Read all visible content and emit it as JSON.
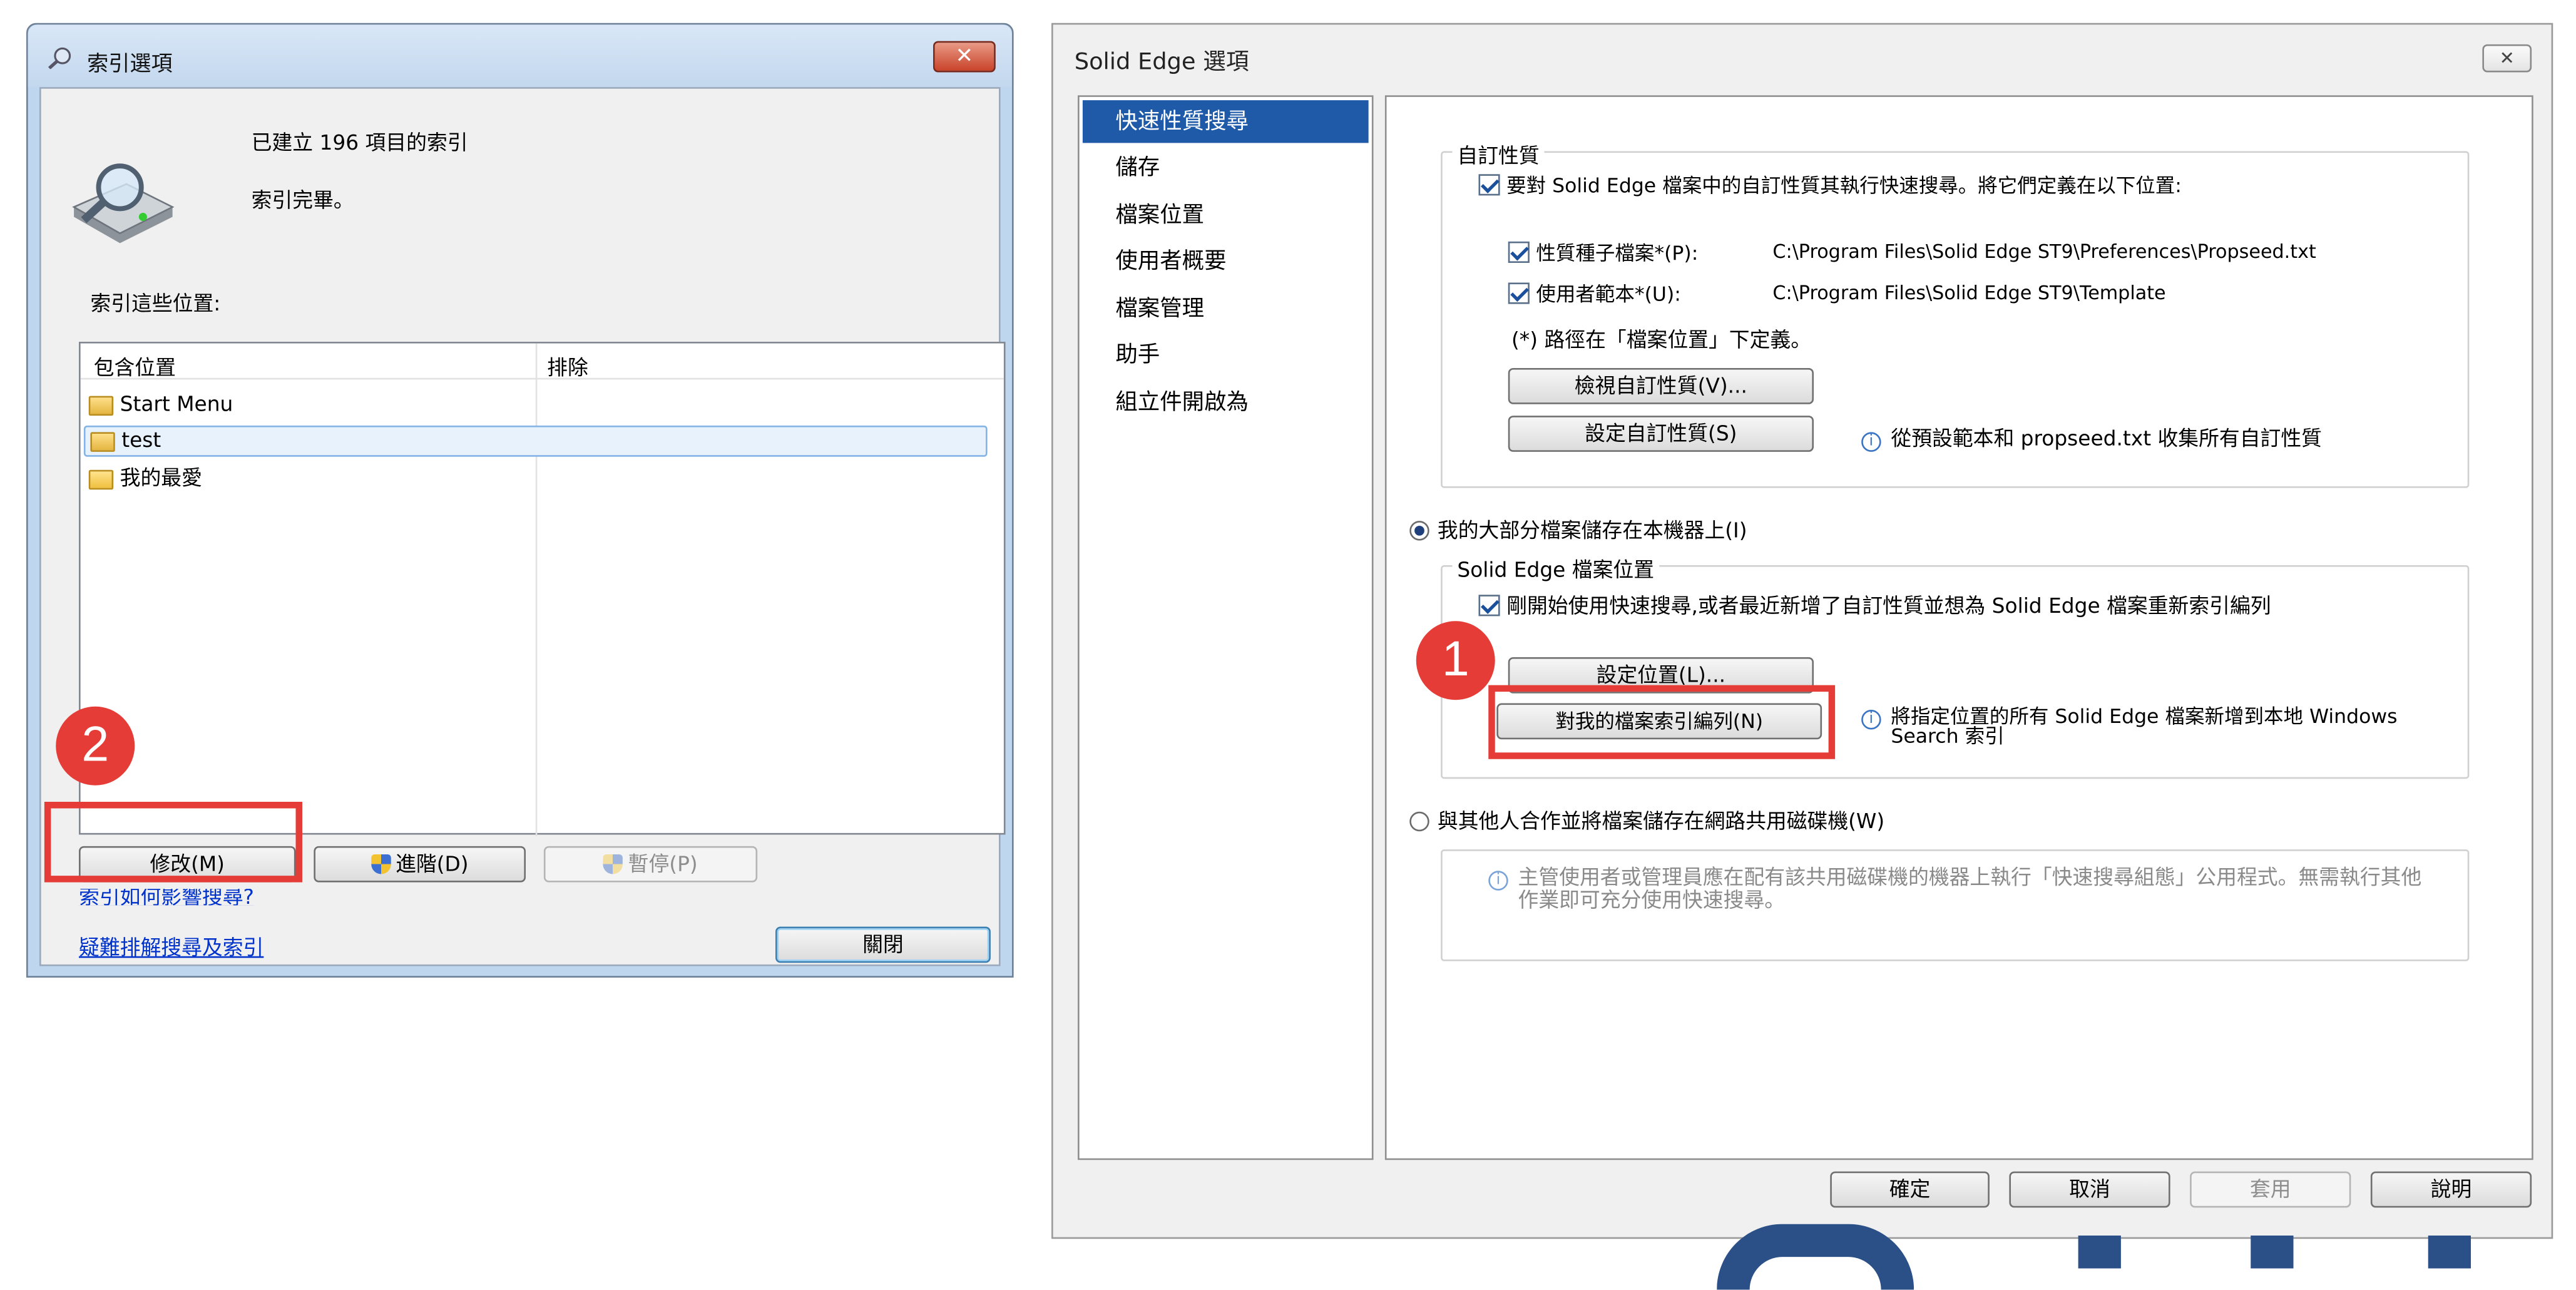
{
  "index_options": {
    "title": "索引選項",
    "status_count": "已建立 196 項目的索引",
    "status_done": "索引完畢。",
    "section_label": "索引這些位置:",
    "columns": [
      "包含位置",
      "排除"
    ],
    "locations": [
      {
        "name": "Start Menu",
        "exclude": ""
      },
      {
        "name": "test",
        "exclude": ""
      },
      {
        "name": "我的最愛",
        "exclude": ""
      }
    ],
    "buttons": {
      "modify": "修改(M)",
      "advanced": "進階(D)",
      "pause": "暫停(P)",
      "close": "關閉"
    },
    "links": {
      "how_affects": "索引如何影響搜尋?",
      "troubleshoot": "疑難排解搜尋及索引"
    },
    "close_glyph": "✕",
    "badge": "2"
  },
  "solid_edge": {
    "title": "Solid Edge 選項",
    "close_glyph": "✕",
    "nav": [
      "快速性質搜尋",
      "儲存",
      "檔案位置",
      "使用者概要",
      "檔案管理",
      "助手",
      "組立件開啟為"
    ],
    "nav_selected": 0,
    "custom_props": {
      "legend": "自訂性質",
      "enable_label": "要對 Solid Edge 檔案中的自訂性質其執行快速搜尋。將它們定義在以下位置:",
      "seed_label": "性質種子檔案*(P):",
      "seed_path": "C:\\Program Files\\Solid Edge ST9\\Preferences\\Propseed.txt",
      "template_label": "使用者範本*(U):",
      "template_path": "C:\\Program Files\\Solid Edge ST9\\Template",
      "note": "(*) 路徑在「檔案位置」下定義。",
      "view_button": "檢視自訂性質(V)...",
      "set_button": "設定自訂性質(S)",
      "set_info": "從預設範本和 propseed.txt 收集所有自訂性質"
    },
    "local_option": "我的大部分檔案儲存在本機器上(I)",
    "file_locations": {
      "legend": "Solid Edge 檔案位置",
      "reindex_label": "剛開始使用快速搜尋,或者最近新增了自訂性質並想為 Solid Edge 檔案重新索引編列",
      "set_location_button": "設定位置(L)...",
      "index_button": "對我的檔案索引編列(N)",
      "index_info": "將指定位置的所有 Solid Edge 檔案新增到本地 Windows Search 索引"
    },
    "network_option": "與其他人合作並將檔案儲存在網路共用磁碟機(W)",
    "network_info": "主管使用者或管理員應在配有該共用磁碟機的機器上執行「快速搜尋組態」公用程式。無需執行其他作業即可充分使用快速搜尋。",
    "footer_buttons": {
      "ok": "確定",
      "cancel": "取消",
      "apply": "套用",
      "help": "說明"
    },
    "badge": "1"
  },
  "colors": {
    "highlight_red": "#e63c37",
    "selection_blue": "#1e5aa8"
  }
}
